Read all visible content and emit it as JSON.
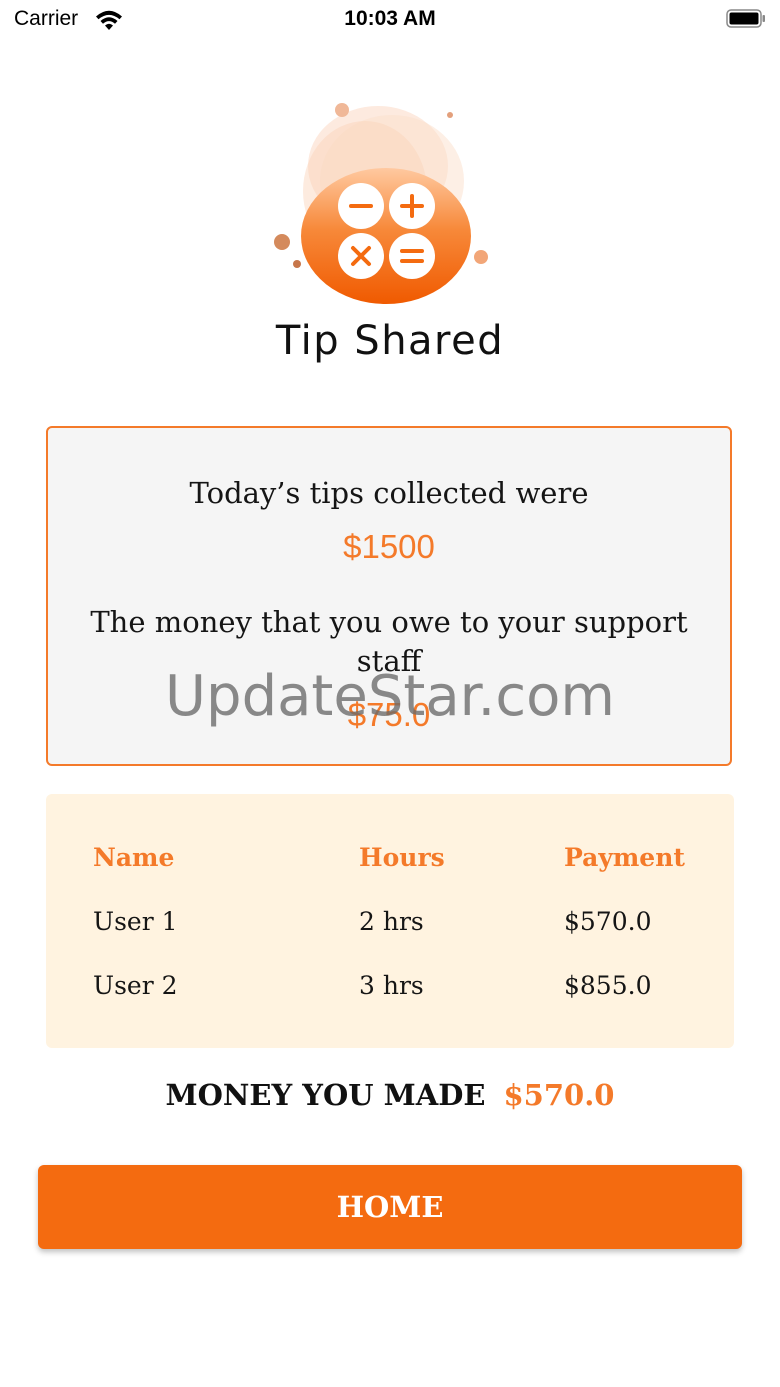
{
  "status_bar": {
    "carrier": "Carrier",
    "time": "10:03 AM",
    "icons": [
      "wifi-icon",
      "battery-icon"
    ]
  },
  "app": {
    "title": "Tip Shared",
    "logo_icon": "calculator-logo-icon",
    "accent_color": "#f46b10"
  },
  "summary": {
    "tips_label": "Today’s tips collected were",
    "tips_amount": "$1500",
    "owe_label": "The money that you owe to your support staff",
    "owe_amount": "$75.0"
  },
  "watermark": "UpdateStar.com",
  "table": {
    "headers": [
      "Name",
      "Hours",
      "Payment"
    ],
    "rows": [
      [
        "User 1",
        "2 hrs",
        "$570.0"
      ],
      [
        "User 2",
        "3 hrs",
        "$855.0"
      ]
    ]
  },
  "money_made": {
    "label": "MONEY YOU MADE",
    "value": "$570.0"
  },
  "home_button": {
    "label": "HOME"
  }
}
